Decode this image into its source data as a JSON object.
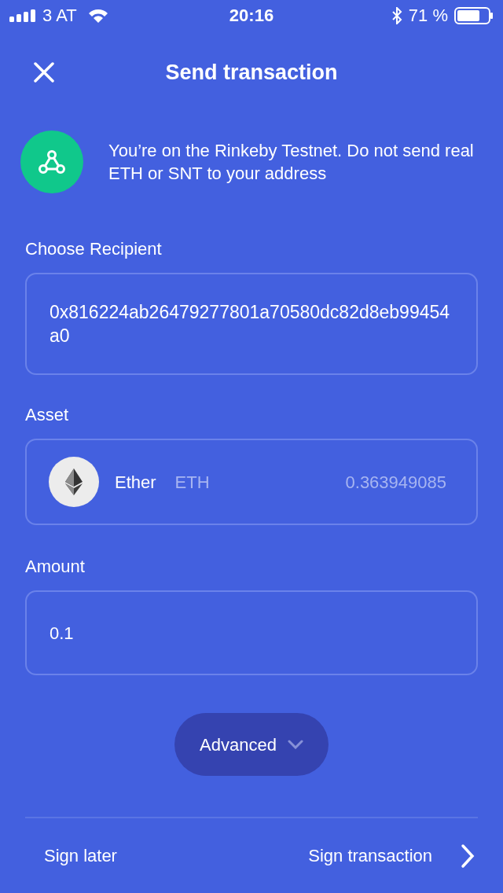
{
  "status_bar": {
    "carrier": "3 AT",
    "time": "20:16",
    "battery": "71 %"
  },
  "header": {
    "title": "Send transaction"
  },
  "notice": {
    "text": "You’re on the Rinkeby Testnet. Do not send real ETH or SNT to your address"
  },
  "recipient": {
    "label": "Choose Recipient",
    "value": "0x816224ab26479277801a70580dc82d8eb99454a0"
  },
  "asset": {
    "label": "Asset",
    "name": "Ether",
    "symbol": "ETH",
    "balance": "0.363949085"
  },
  "amount": {
    "label": "Amount",
    "value": "0.1"
  },
  "advanced": {
    "label": "Advanced",
    "expanded": false
  },
  "footer": {
    "secondary": "Sign later",
    "primary": "Sign transaction"
  }
}
